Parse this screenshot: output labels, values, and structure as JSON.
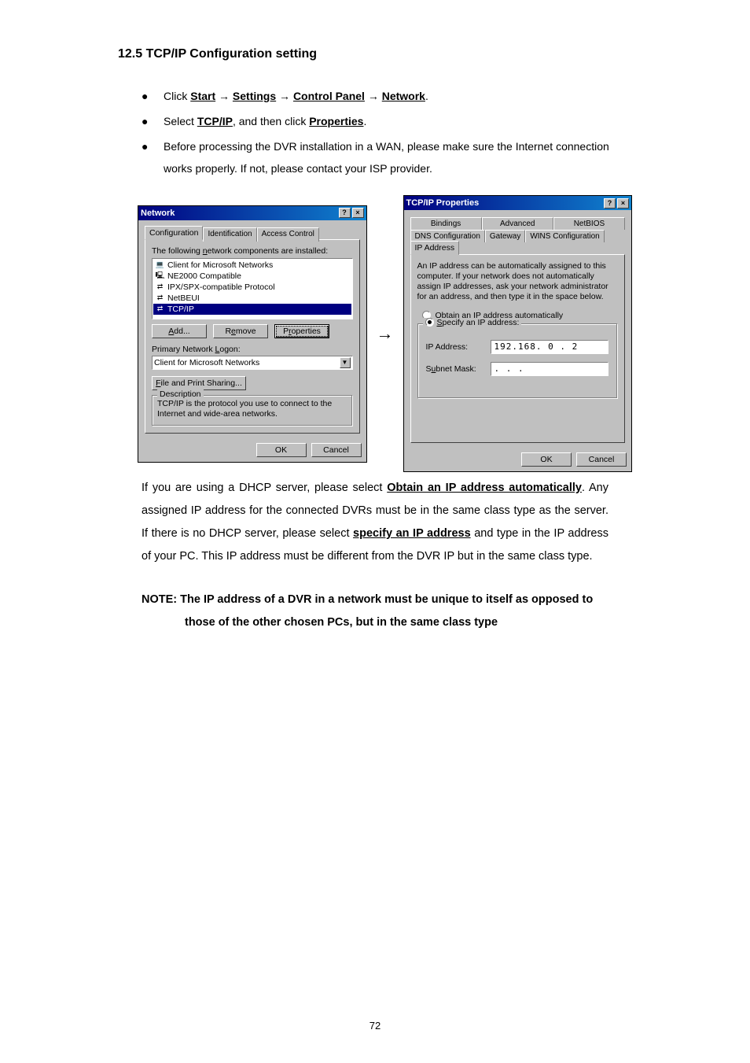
{
  "section_title": "12.5 TCP/IP Configuration setting",
  "bullets": {
    "b1_prefix": "Click ",
    "b1_start": "Start",
    "b1_arrow": " → ",
    "b1_settings": "Settings",
    "b1_cp": "Control Panel",
    "b1_network": "Network",
    "b1_period": ".",
    "b2_prefix": "Select ",
    "b2_tcpip": "TCP/IP",
    "b2_mid": ", and then click ",
    "b2_props": "Properties",
    "b2_period": ".",
    "b3": "Before processing the DVR installation in a WAN, please make sure the Internet connection works properly. If not, please contact your ISP provider."
  },
  "network_dialog": {
    "title": "Network",
    "help_btn": "?",
    "close_btn": "×",
    "tabs": {
      "configuration": "Configuration",
      "identification": "Identification",
      "access_control": "Access Control"
    },
    "components_label": "The following network components are installed:",
    "items": [
      "Client for Microsoft Networks",
      "NE2000 Compatible",
      "IPX/SPX-compatible Protocol",
      "NetBEUI",
      "TCP/IP"
    ],
    "add_btn": "Add...",
    "remove_btn": "Remove",
    "properties_btn": "Properties",
    "primary_logon_label": "Primary Network Logon:",
    "primary_logon_value": "Client for Microsoft Networks",
    "file_print_btn": "File and Print Sharing...",
    "desc_label": "Description",
    "desc_text": "TCP/IP is the protocol you use to connect to the Internet and wide-area networks.",
    "ok_btn": "OK",
    "cancel_btn": "Cancel"
  },
  "mid_arrow": "→",
  "tcpip_dialog": {
    "title": "TCP/IP Properties",
    "help_btn": "?",
    "close_btn": "×",
    "tabs_top": {
      "bindings": "Bindings",
      "advanced": "Advanced",
      "netbios": "NetBIOS"
    },
    "tabs_bottom": {
      "dns": "DNS Configuration",
      "gateway": "Gateway",
      "wins": "WINS Configuration",
      "ipaddr": "IP Address"
    },
    "info_text": "An IP address can be automatically assigned to this computer. If your network does not automatically assign IP addresses, ask your network administrator for an address, and then type it in the space below.",
    "radio_obtain": "Obtain an IP address automatically",
    "radio_specify": "Specify an IP address:",
    "ip_label": "IP Address:",
    "ip_value": "192.168.  0 .  2",
    "subnet_label": "Subnet Mask:",
    "subnet_value": "   .   .   .   ",
    "ok_btn": "OK",
    "cancel_btn": "Cancel"
  },
  "para1_a": "If you are using a DHCP server, please select ",
  "para1_obtain": "Obtain an IP address automatically",
  "para1_b": ". Any assigned IP address for the connected DVRs must be in the same class type as the server. If there is no DHCP server, please select ",
  "para1_specify": "specify an IP address",
  "para1_c": " and type in the IP address of your PC. This IP address must be different from the DVR IP but in the same class type.",
  "note_line1": "NOTE: The IP address of a DVR in a network must be unique to itself as opposed to",
  "note_line2": "those of the other chosen PCs, but in the same class type",
  "page_number": "72"
}
